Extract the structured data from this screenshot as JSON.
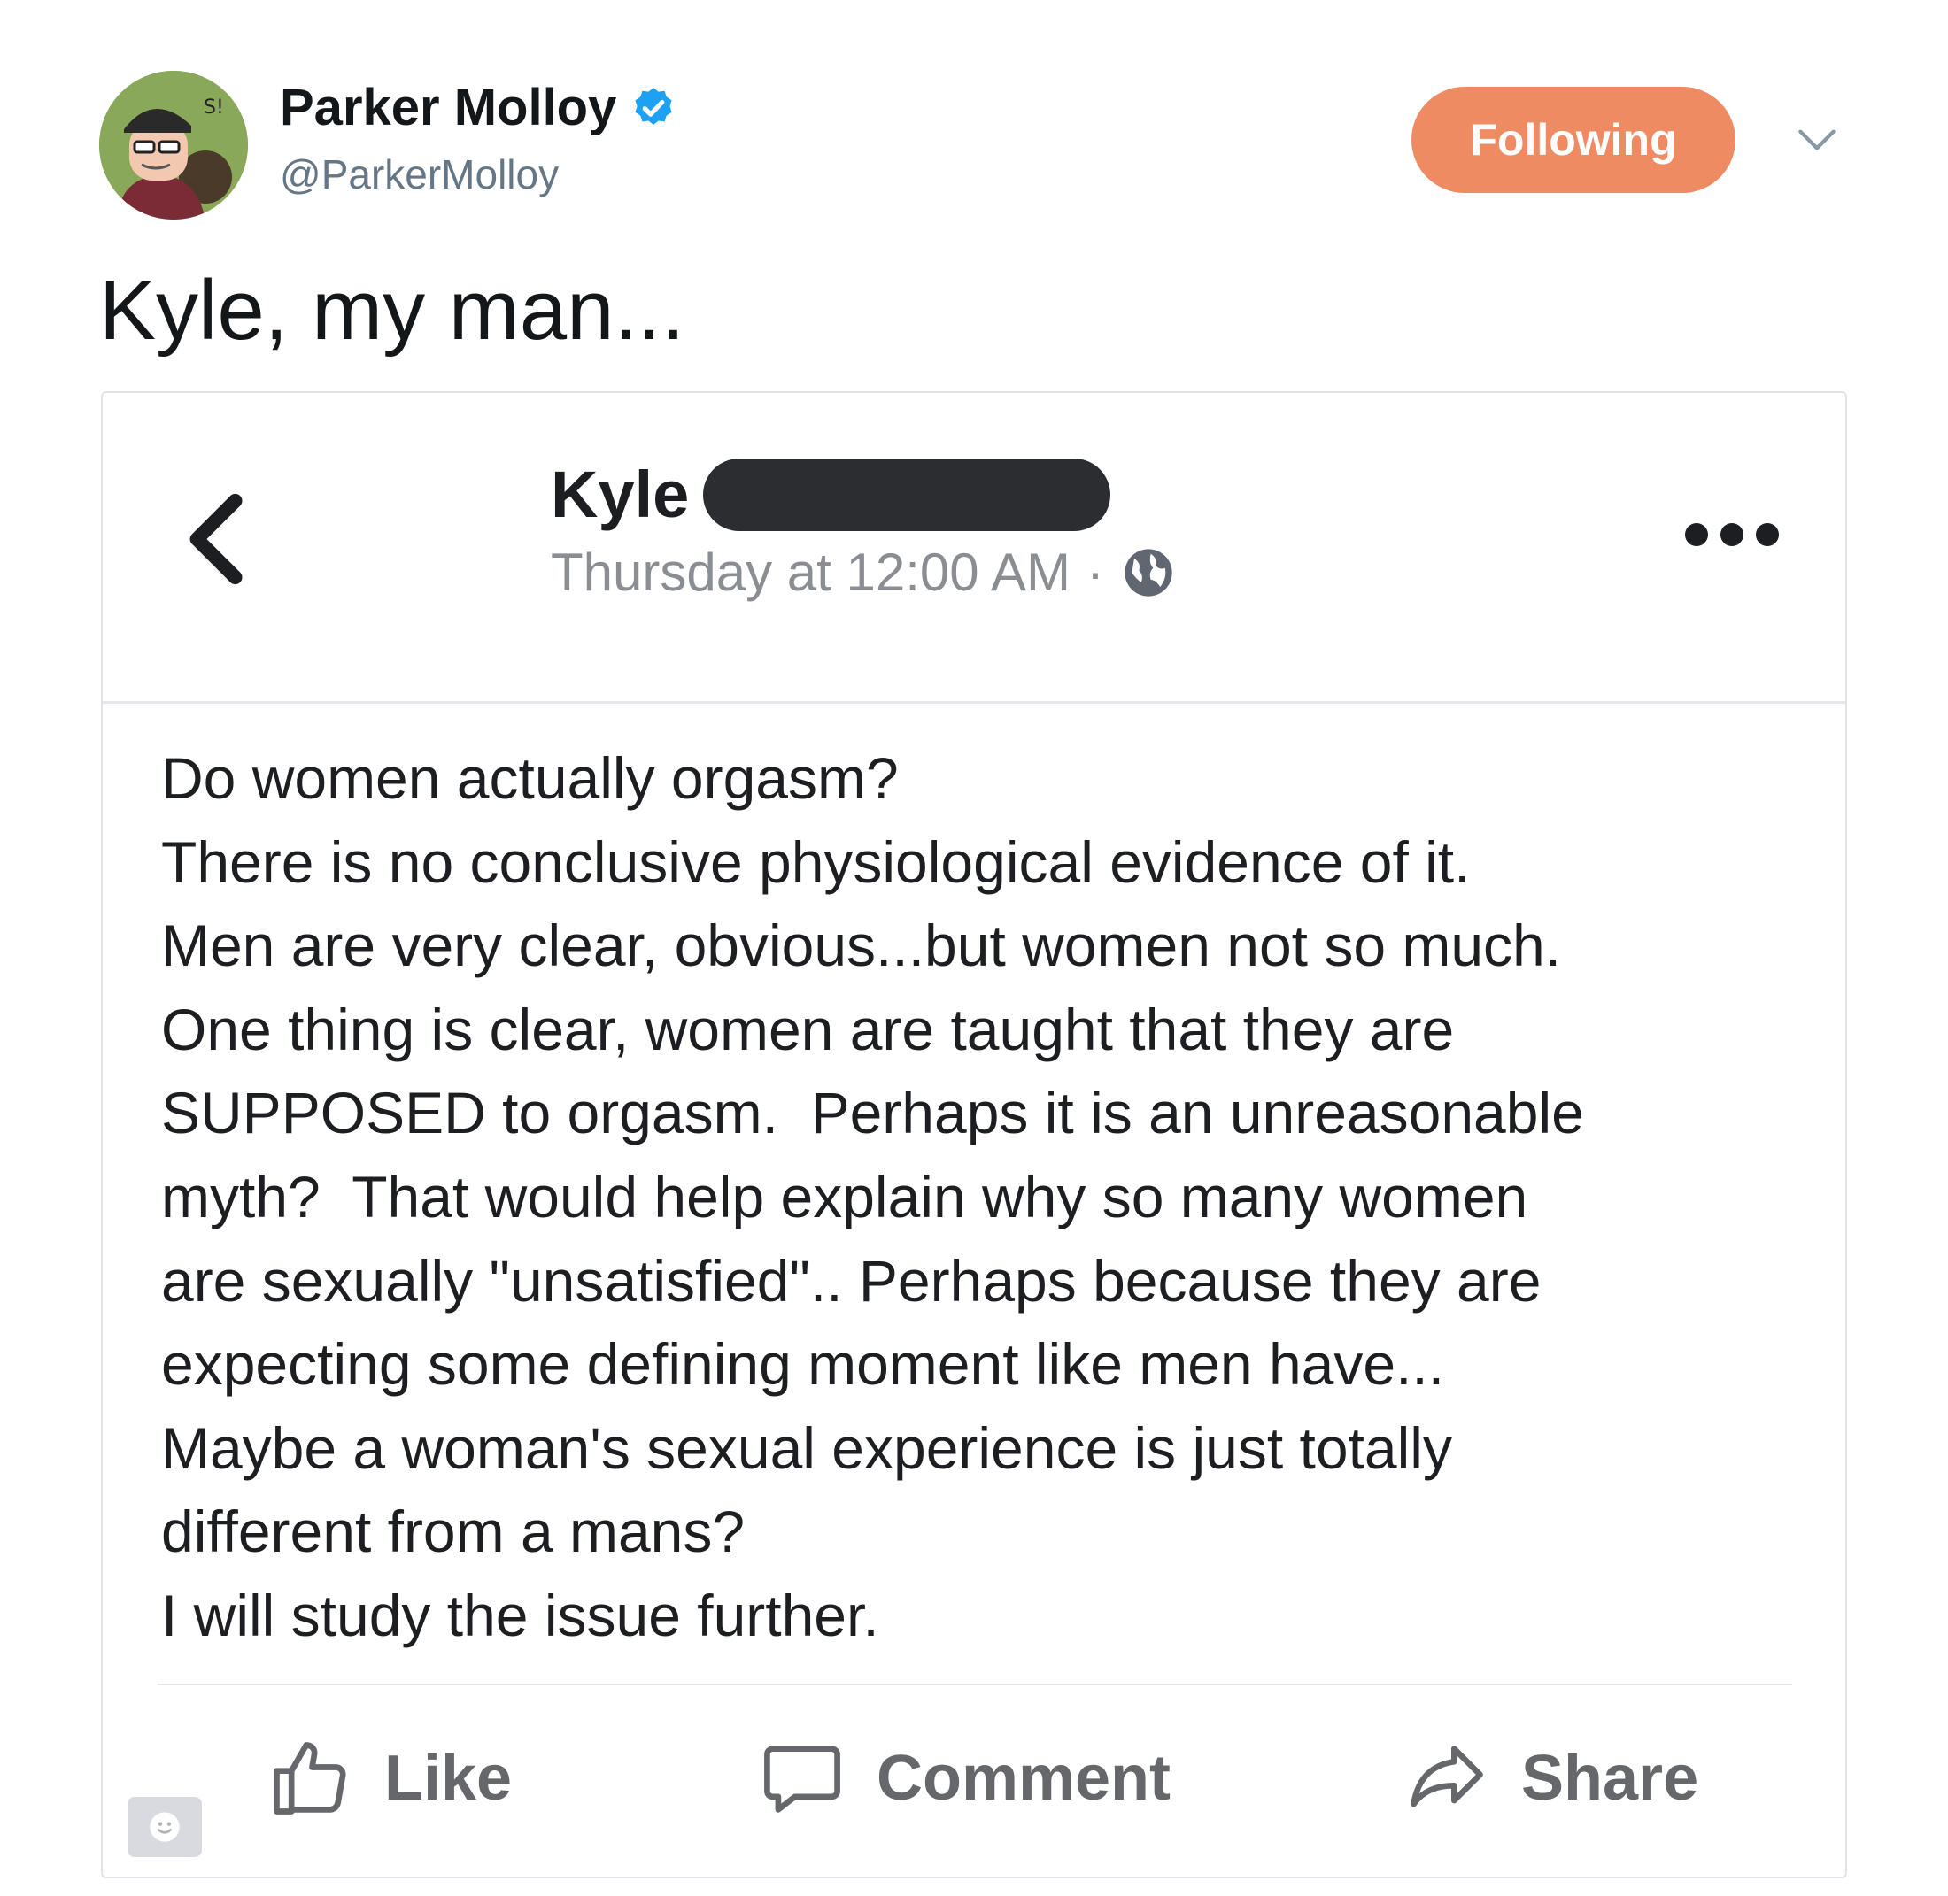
{
  "tweet": {
    "author_name": "Parker Molloy",
    "author_handle": "@ParkerMolloy",
    "follow_label": "Following",
    "text": "Kyle, my man...",
    "avatar_icon": "cartoon-avatar-icon",
    "verified_icon": "verified-badge-icon",
    "accent_color": "#ee8b63"
  },
  "fb_post": {
    "author_name": "Kyle",
    "timestamp": "Thursday at 12:00 AM",
    "separator": "·",
    "privacy_icon": "globe-icon",
    "body_lines": [
      "Do women actually orgasm?",
      "There is no conclusive physiological evidence of it.",
      "Men are very clear, obvious...but women not so much.",
      "One thing is clear, women are taught that they are",
      "SUPPOSED to orgasm.  Perhaps it is an unreasonable",
      "myth?  That would help explain why so many women",
      "are sexually \"unsatisfied\".. Perhaps because they are",
      "expecting some defining moment like men have...",
      "Maybe a woman's sexual experience is just totally",
      "different from a mans?",
      "I will study the issue further."
    ],
    "actions": {
      "like": "Like",
      "comment": "Comment",
      "share": "Share"
    }
  }
}
